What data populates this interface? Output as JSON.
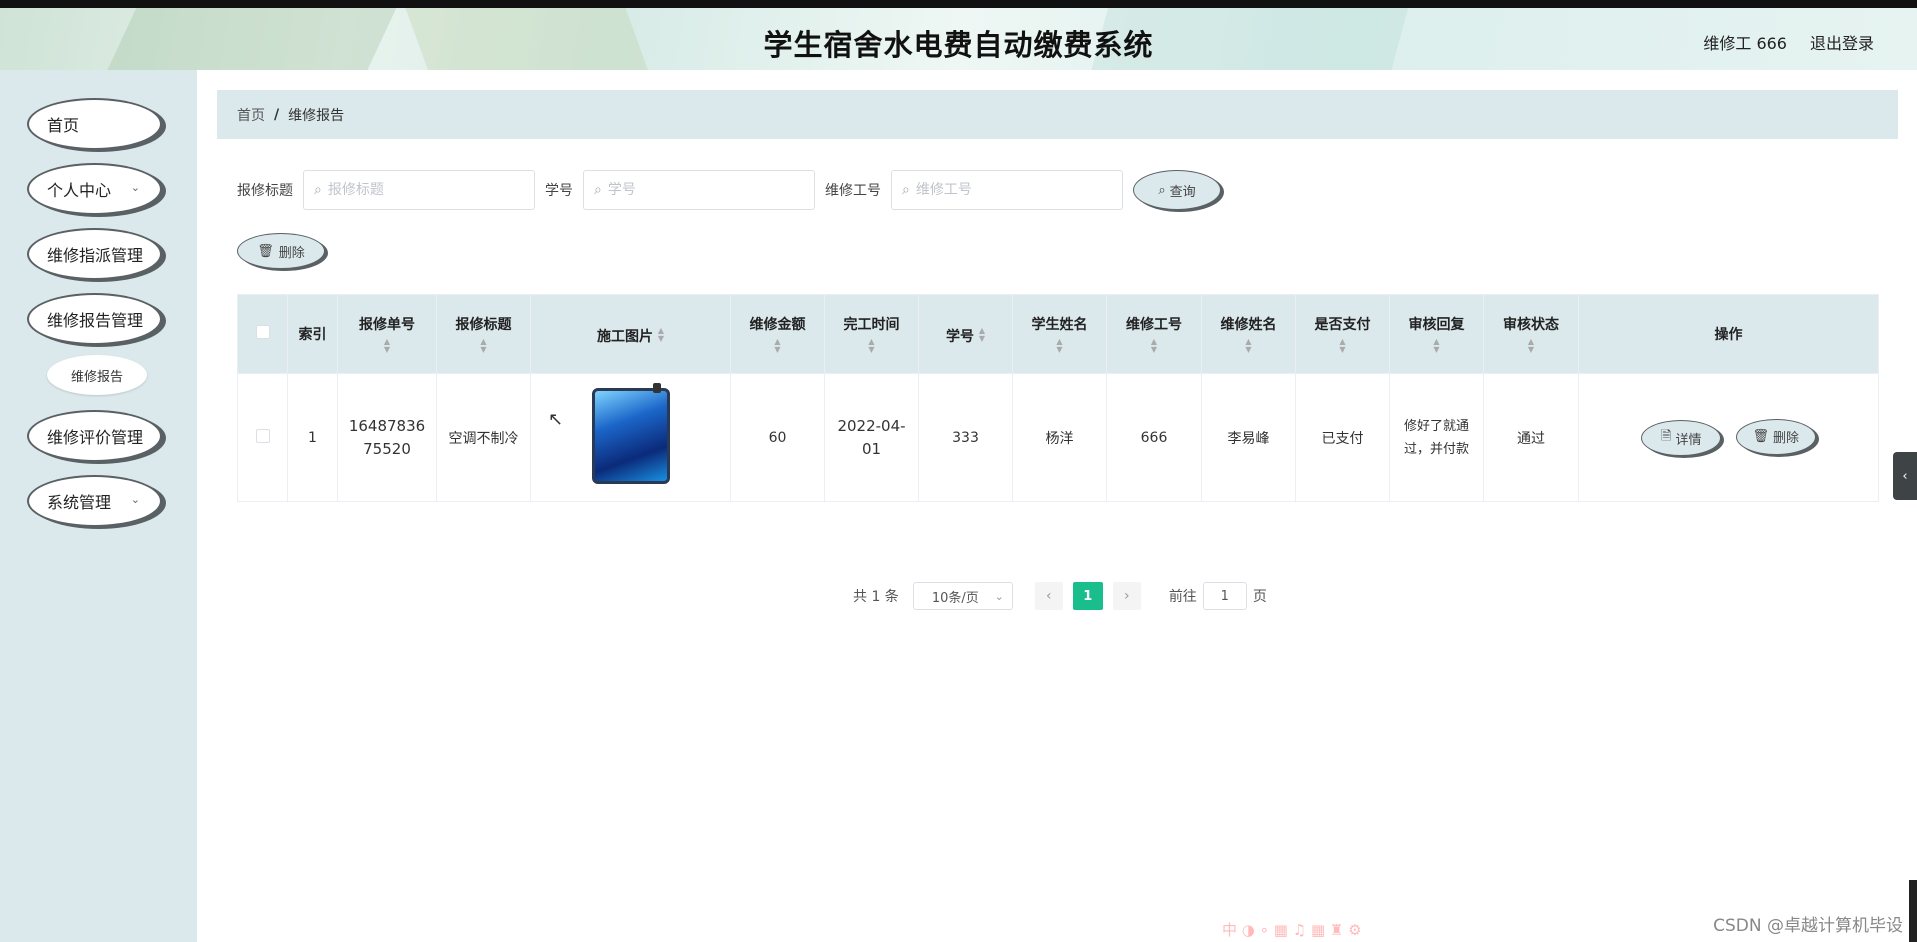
{
  "header": {
    "title": "学生宿舍水电费自动缴费系统",
    "user": "维修工 666",
    "logout": "退出登录"
  },
  "sidebar": {
    "items": [
      {
        "label": "首页"
      },
      {
        "label": "个人中心"
      },
      {
        "label": "维修指派管理"
      },
      {
        "label": "维修报告管理"
      },
      {
        "label": "维修报告"
      },
      {
        "label": "维修评价管理"
      },
      {
        "label": "系统管理"
      }
    ]
  },
  "breadcrumb": {
    "home": "首页",
    "sep": "/",
    "current": "维修报告"
  },
  "search": {
    "title_label": "报修标题",
    "title_placeholder": "报修标题",
    "student_label": "学号",
    "student_placeholder": "学号",
    "worker_label": "维修工号",
    "worker_placeholder": "维修工号",
    "query_button": "查询"
  },
  "toolbar": {
    "delete_button": "删除"
  },
  "table": {
    "columns": [
      "索引",
      "报修单号",
      "报修标题",
      "施工图片",
      "维修金额",
      "完工时间",
      "学号",
      "学生姓名",
      "维修工号",
      "维修姓名",
      "是否支付",
      "审核回复",
      "审核状态",
      "操作"
    ],
    "rows": [
      {
        "index": "1",
        "order_no": "1648783675520",
        "title": "空调不制冷",
        "amount": "60",
        "finish_time": "2022-04-01",
        "student_no": "333",
        "student_name": "杨洋",
        "worker_no": "666",
        "worker_name": "李易峰",
        "paid": "已支付",
        "reply": "修好了就通过，并付款",
        "status": "通过",
        "detail_button": "详情",
        "delete_button": "删除"
      }
    ]
  },
  "pager": {
    "total": "共 1 条",
    "page_size": "10条/页",
    "current_page": "1",
    "goto_label": "前往",
    "goto_value": "1",
    "page_suffix": "页"
  },
  "watermark": "CSDN @卓越计算机毕设",
  "ime_bar": "中 ◑ ∘ ▦ ♫ ▦ ♜ ⚙"
}
